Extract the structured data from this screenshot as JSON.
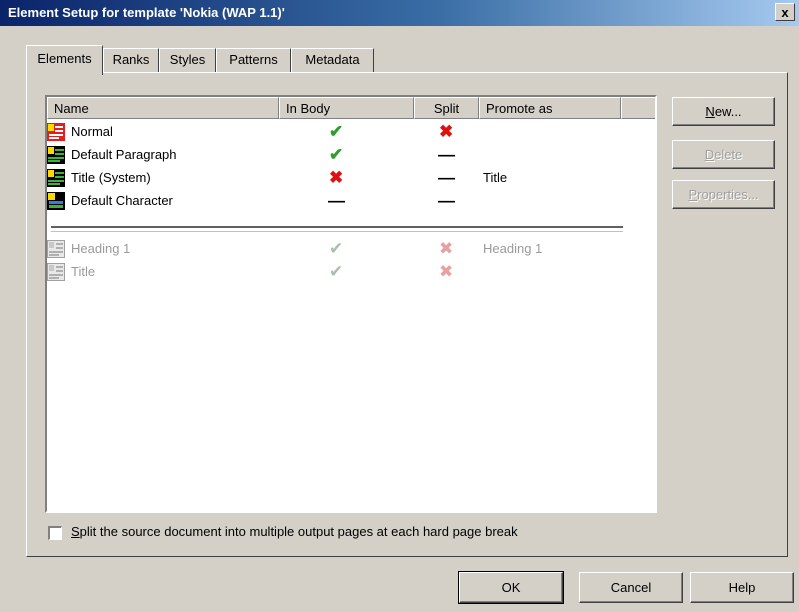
{
  "window": {
    "title": "Element Setup for template 'Nokia (WAP 1.1)'",
    "close_label": "x"
  },
  "tabs": [
    {
      "label": "Elements",
      "active": true
    },
    {
      "label": "Ranks",
      "active": false
    },
    {
      "label": "Styles",
      "active": false
    },
    {
      "label": "Patterns",
      "active": false
    },
    {
      "label": "Metadata",
      "active": false
    }
  ],
  "list": {
    "columns": [
      "Name",
      "In Body",
      "Split",
      "Promote as"
    ],
    "rows": [
      {
        "name": "Normal",
        "in_body": "✔",
        "split": "✖",
        "promote_as": "",
        "enabled": true
      },
      {
        "name": "Default Paragraph",
        "in_body": "✔",
        "split": "—",
        "promote_as": "",
        "enabled": true
      },
      {
        "name": "Title (System)",
        "in_body": "✖",
        "split": "—",
        "promote_as": "Title",
        "enabled": true
      },
      {
        "name": "Default Character",
        "in_body": "—",
        "split": "—",
        "promote_as": "",
        "enabled": true
      },
      {
        "name": "Heading 1",
        "in_body": "✔",
        "split": "✖",
        "promote_as": "Heading 1",
        "enabled": false
      },
      {
        "name": "Title",
        "in_body": "✔",
        "split": "✖",
        "promote_as": "",
        "enabled": false
      }
    ]
  },
  "side_buttons": {
    "new": {
      "pre": "",
      "accel": "N",
      "post": "ew..."
    },
    "delete": {
      "pre": "",
      "accel": "D",
      "post": "elete"
    },
    "properties": {
      "pre": "",
      "accel": "P",
      "post": "roperties..."
    }
  },
  "split_option": {
    "checked": false,
    "label_accel": "S",
    "label_rest": "plit the source document into multiple output pages at each hard page break"
  },
  "footer_buttons": {
    "ok": "OK",
    "cancel": "Cancel",
    "help": "Help"
  },
  "colors": {
    "titlebar_start": "#0a246a",
    "titlebar_end": "#a6caf0",
    "check_green": "#2e9e2e",
    "cross_red": "#e01010",
    "face": "#d4d0c8"
  }
}
